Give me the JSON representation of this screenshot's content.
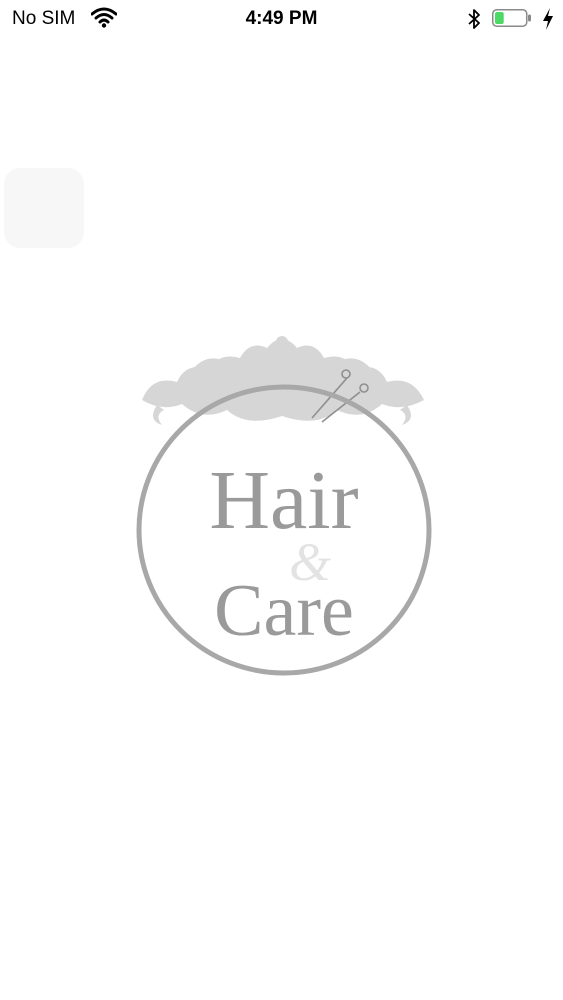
{
  "status_bar": {
    "carrier": "No SIM",
    "time": "4:49 PM",
    "icons": [
      "wifi-icon",
      "bluetooth-icon",
      "battery-icon",
      "charging-icon"
    ],
    "battery_level": 0.3,
    "battery_color": "#4cd964"
  },
  "splash": {
    "logo_words": [
      "Hair",
      "&",
      "Care"
    ],
    "logo_color": "#9a9a9a"
  }
}
